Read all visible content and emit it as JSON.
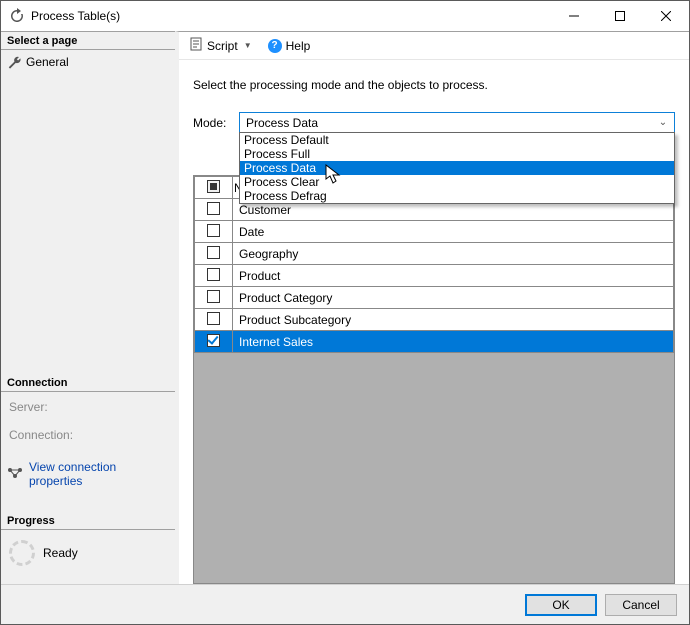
{
  "window": {
    "title": "Process Table(s)"
  },
  "sidebar": {
    "select_page_header": "Select a page",
    "pages": [
      {
        "label": "General"
      }
    ],
    "connection_header": "Connection",
    "server_label": "Server:",
    "connection_label": "Connection:",
    "view_conn_props": "View connection properties",
    "progress_header": "Progress",
    "progress_status": "Ready"
  },
  "toolbar": {
    "script_label": "Script",
    "help_label": "Help"
  },
  "content": {
    "instruction": "Select the processing mode and the objects to process.",
    "mode_label": "Mode:",
    "mode_selected": "Process Data",
    "mode_options": [
      {
        "label": "Process Default",
        "selected": false
      },
      {
        "label": "Process Full",
        "selected": false
      },
      {
        "label": "Process Data",
        "selected": true
      },
      {
        "label": "Process Clear",
        "selected": false
      },
      {
        "label": "Process Defrag",
        "selected": false
      }
    ],
    "table": {
      "header_name": "Name",
      "rows": [
        {
          "name": "Customer",
          "checked": false,
          "selected": false
        },
        {
          "name": "Date",
          "checked": false,
          "selected": false
        },
        {
          "name": "Geography",
          "checked": false,
          "selected": false
        },
        {
          "name": "Product",
          "checked": false,
          "selected": false
        },
        {
          "name": "Product Category",
          "checked": false,
          "selected": false
        },
        {
          "name": "Product Subcategory",
          "checked": false,
          "selected": false
        },
        {
          "name": "Internet Sales",
          "checked": true,
          "selected": true
        }
      ]
    }
  },
  "footer": {
    "ok": "OK",
    "cancel": "Cancel"
  }
}
